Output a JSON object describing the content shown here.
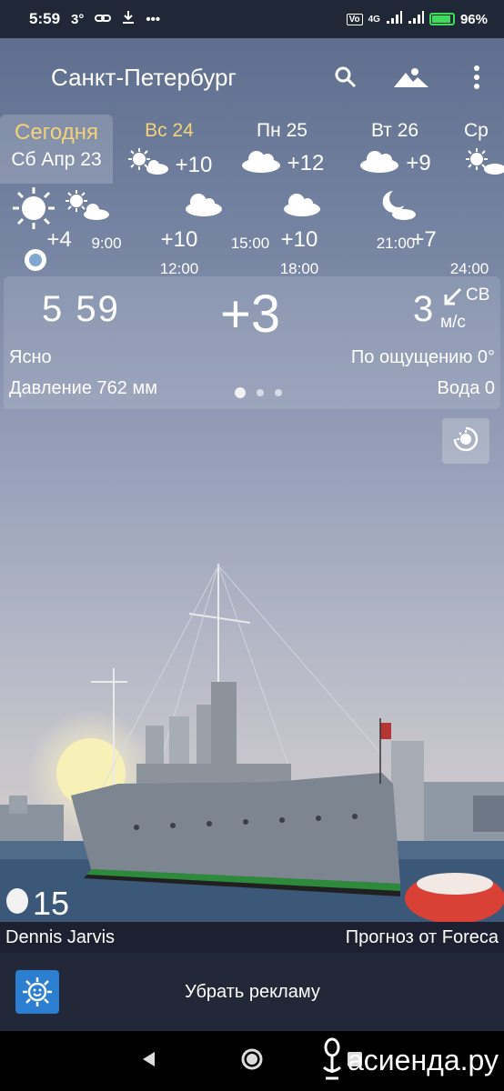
{
  "status": {
    "time": "5:59",
    "temp_icon_text": "3°",
    "network": "4G",
    "battery": "96%"
  },
  "app": {
    "city": "Санкт-Петербург",
    "search_icon": "search-icon",
    "photo_icon": "landscape-icon",
    "menu_icon": "more-vertical-icon"
  },
  "days": [
    {
      "name": "Сегодня",
      "date": "Сб Апр 23"
    },
    {
      "name": "Вс 24",
      "temp": "+10",
      "icon": "sun-cloud-icon"
    },
    {
      "name": "Пн 25",
      "temp": "+12",
      "icon": "cloud-icon"
    },
    {
      "name": "Вт 26",
      "temp": "+9",
      "icon": "cloud-icon"
    },
    {
      "name": "Ср",
      "temp": "",
      "icon": "sun-cloud-icon"
    }
  ],
  "hours": [
    {
      "temp": "+4",
      "time": ""
    },
    {
      "temp": "",
      "time": "9:00"
    },
    {
      "temp": "+10",
      "time": "12:00"
    },
    {
      "temp": "",
      "time": "15:00"
    },
    {
      "temp": "+10",
      "time": "18:00"
    },
    {
      "temp": "",
      "time": "21:00"
    },
    {
      "temp": "+7",
      "time": "24:00"
    }
  ],
  "current": {
    "clock": "5 59",
    "temp": "+3",
    "wind_speed": "3",
    "wind_dir": "СВ",
    "wind_unit": "м/с",
    "condition": "Ясно",
    "feels_like": "По ощущению 0°",
    "pressure": "Давление 762 мм",
    "water": "Вода 0"
  },
  "photo": {
    "likes": "15",
    "author": "Dennis Jarvis",
    "provider": "Прогноз от Foreca"
  },
  "ad": {
    "label": "Убрать рекламу"
  },
  "watermark": "асиенда.ру",
  "colors": {
    "today_accent": "#f3d27a",
    "bar_dark": "#232838",
    "battery_green": "#3ddc5a"
  }
}
